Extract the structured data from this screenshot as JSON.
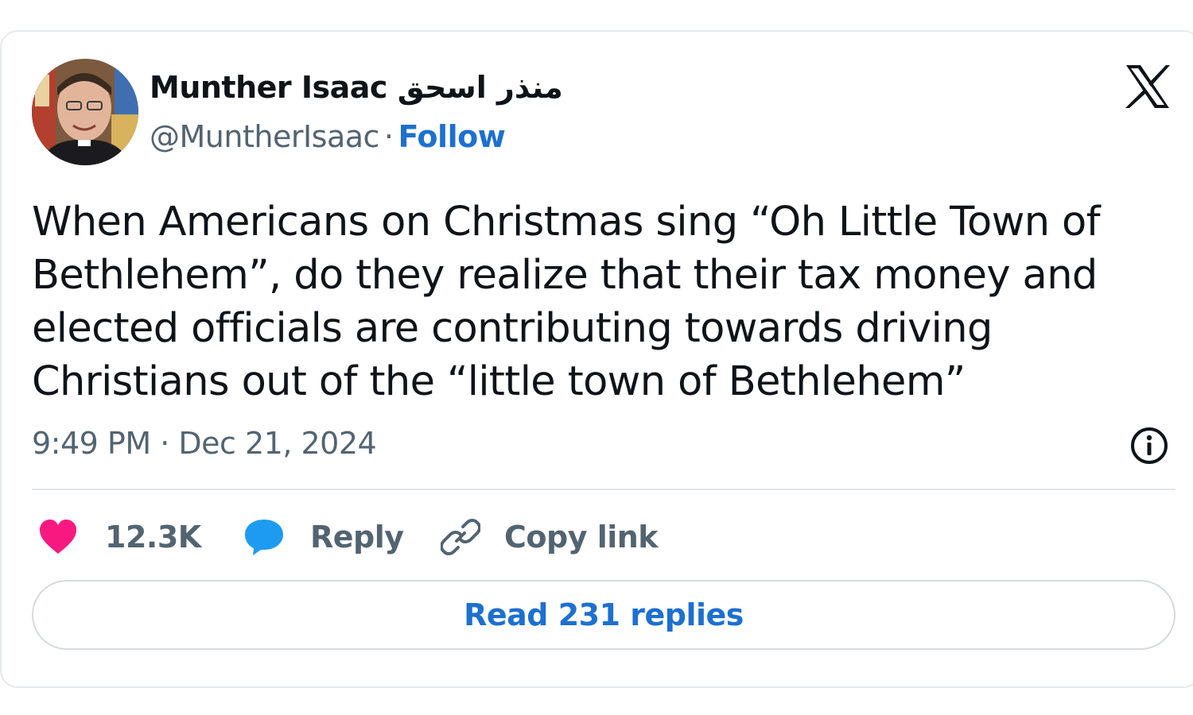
{
  "author": {
    "display_name": "Munther Isaac منذر اسحق",
    "handle": "@MuntherIsaac",
    "separator": "·",
    "follow_label": "Follow"
  },
  "tweet": {
    "text": "When Americans on Christmas sing “Oh Little Town of Bethlehem”, do they realize that their tax money and elected officials are contributing towards driving Christians out of the “little town of Bethlehem”",
    "timestamp": "9:49 PM · Dec 21, 2024"
  },
  "actions": {
    "like_count": "12.3K",
    "reply_label": "Reply",
    "copy_link_label": "Copy link"
  },
  "footer": {
    "read_replies_label": "Read 231 replies"
  },
  "colors": {
    "like": "#f91880",
    "reply": "#1d9bf0",
    "link": "#1d70cf",
    "secondary_text": "#536471"
  },
  "icons": [
    "x-logo-icon",
    "info-icon",
    "heart-icon",
    "speech-bubble-icon",
    "link-icon"
  ]
}
